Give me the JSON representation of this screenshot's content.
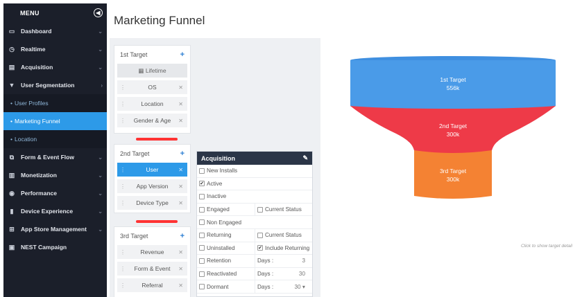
{
  "sidebar": {
    "title": "MENU",
    "toggle_icon": "◀",
    "items": [
      {
        "label": "Dashboard",
        "icon": "▭"
      },
      {
        "label": "Realtime",
        "icon": "◷"
      },
      {
        "label": "Acquisition",
        "icon": "▤"
      },
      {
        "label": "User Segmentation",
        "icon": "▼"
      }
    ],
    "sub_items": [
      {
        "label": "User Profiles"
      },
      {
        "label": "Marketing Funnel"
      },
      {
        "label": "Location"
      }
    ],
    "items2": [
      {
        "label": "Form & Event Flow",
        "icon": "⧉"
      },
      {
        "label": "Monetization",
        "icon": "▥"
      },
      {
        "label": "Performance",
        "icon": "◉"
      },
      {
        "label": "Device Experience",
        "icon": "▮"
      },
      {
        "label": "App Store Management",
        "icon": "⊞"
      },
      {
        "label": "NEST Campaign",
        "icon": "▣"
      }
    ]
  },
  "page": {
    "title": "Marketing Funnel"
  },
  "targets": [
    {
      "title": "1st Target",
      "add": "+",
      "lifetime": "Lifetime",
      "rows": [
        "OS",
        "Location",
        "Gender & Age"
      ]
    },
    {
      "title": "2nd Target",
      "add": "+",
      "rows": [
        "User",
        "App Version",
        "Device Type"
      ]
    },
    {
      "title": "3rd Target",
      "add": "+",
      "rows": [
        "Revenue",
        "Form & Event",
        "Referral"
      ]
    }
  ],
  "acquisition": {
    "title": "Acquisition",
    "rows": [
      {
        "label": "New Installs",
        "checked": false
      },
      {
        "label": "Active",
        "checked": true
      },
      {
        "label": "Inactive",
        "checked": false
      },
      {
        "label": "Engaged",
        "checked": false,
        "extra": "Current Status",
        "extra_checked": false
      },
      {
        "label": "Non Engaged",
        "checked": false
      },
      {
        "label": "Returning",
        "checked": false,
        "extra": "Current Status",
        "extra_checked": false
      },
      {
        "label": "Uninstalled",
        "checked": false,
        "extra": "Include Returning",
        "extra_checked": true
      },
      {
        "label": "Retention",
        "checked": false,
        "days_label": "Days :",
        "days": "3"
      },
      {
        "label": "Reactivated",
        "checked": false,
        "days_label": "Days :",
        "days": "30"
      },
      {
        "label": "Dormant",
        "checked": false,
        "days_label": "Days :",
        "days": "30 ▾"
      }
    ]
  },
  "funnel": {
    "stages": [
      {
        "label": "1st Target",
        "value": "556k",
        "color": "#4a9be8"
      },
      {
        "label": "2nd Target",
        "value": "300k",
        "color": "#ee3a48"
      },
      {
        "label": "3rd Target",
        "value": "300k",
        "color": "#f48233"
      }
    ],
    "hint": "Click to show target detail"
  }
}
